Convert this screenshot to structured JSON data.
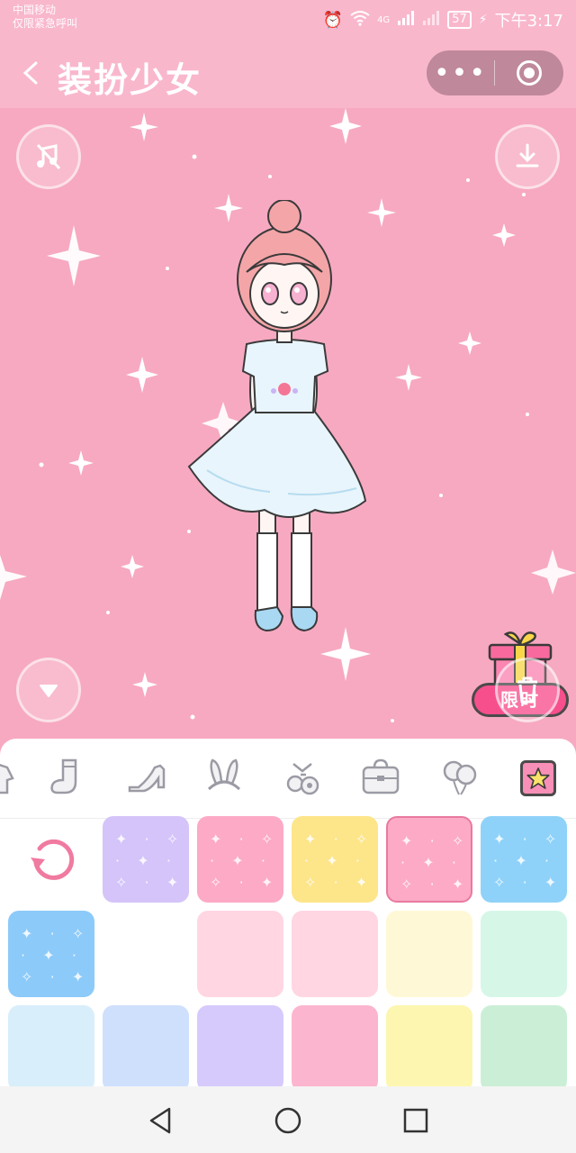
{
  "status": {
    "carrier_line1": "中国移动",
    "carrier_line2": "仅限紧急呼叫",
    "signal": "4G",
    "battery": "57",
    "time": "下午3:17"
  },
  "title_bar": {
    "title": "装扮少女",
    "more_label": "•••"
  },
  "stage": {
    "limited_label": "限时"
  },
  "categories": [
    {
      "name": "clothing",
      "icon": "clothes-icon"
    },
    {
      "name": "socks",
      "icon": "sock-icon"
    },
    {
      "name": "shoes",
      "icon": "high-heel-icon"
    },
    {
      "name": "headwear",
      "icon": "bunny-ears-icon"
    },
    {
      "name": "accessories",
      "icon": "flower-hairpin-icon"
    },
    {
      "name": "bags",
      "icon": "bag-icon"
    },
    {
      "name": "handheld",
      "icon": "balloon-icon"
    },
    {
      "name": "background",
      "icon": "star-frame-icon",
      "active": true
    }
  ],
  "backgrounds": {
    "row1": [
      "#d4c4f9",
      "#fcaac6",
      "#fde58a",
      "#fcaac6",
      "#8fd2f9"
    ],
    "row2": [
      "#8ccaf9",
      "#ffffff",
      "#ffd6e2",
      "#ffd6e2",
      "#fff8d6",
      "#d6f7e8"
    ],
    "row3": [
      "#d8eefb",
      "#cfe0fd",
      "#d6cafc",
      "#fcb5cf",
      "#fdf6b0",
      "#cbefd6"
    ]
  },
  "colors": {
    "accent": "#f78fb6",
    "stage_bg": "#f7a9c1",
    "limited_bg": "#f64f8c"
  }
}
